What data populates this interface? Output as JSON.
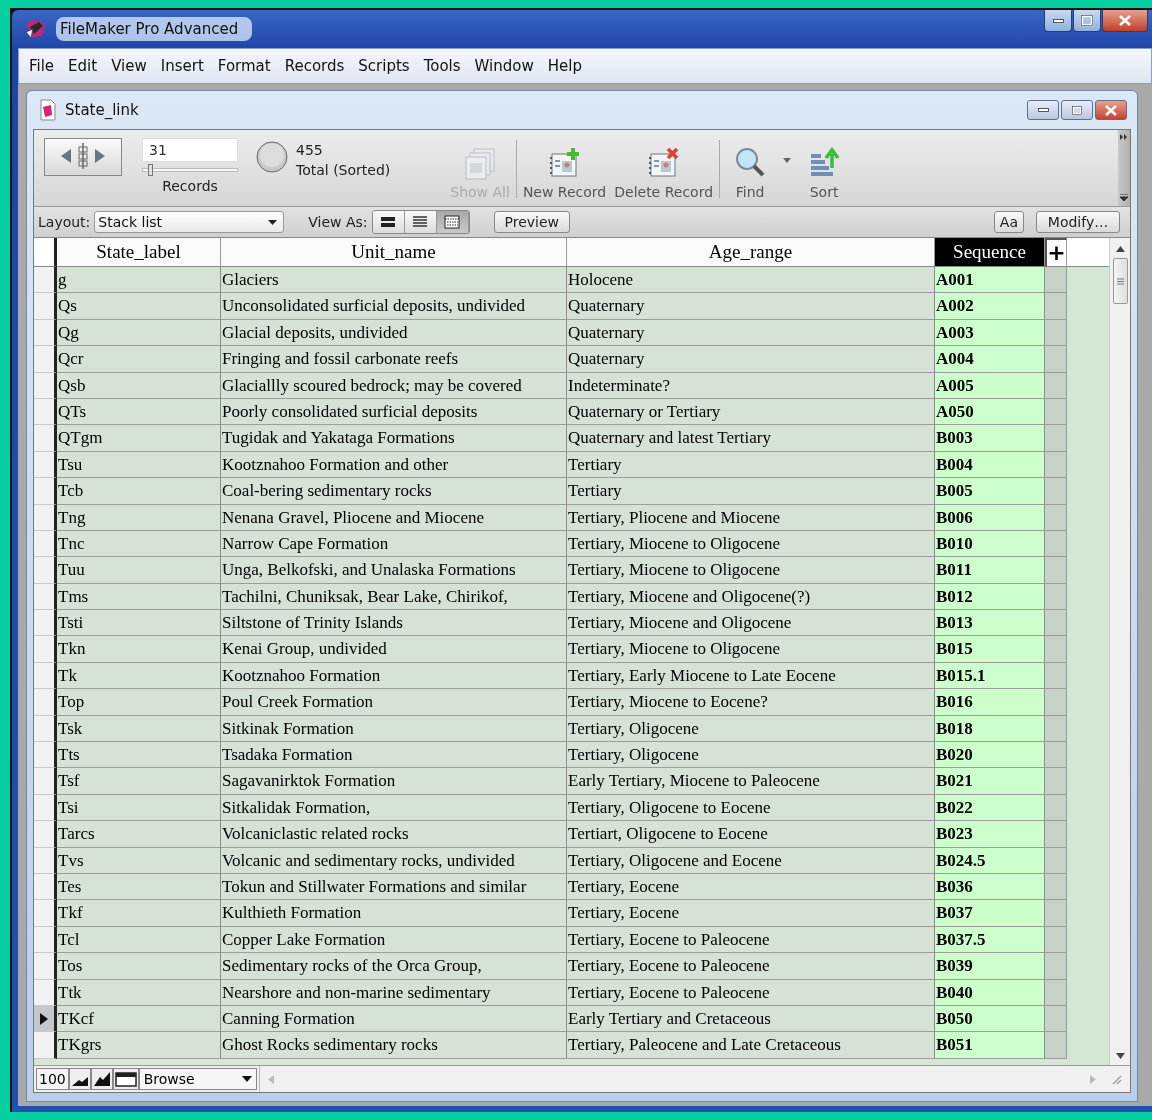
{
  "app": {
    "title": "FileMaker Pro Advanced"
  },
  "menu": [
    "File",
    "Edit",
    "View",
    "Insert",
    "Format",
    "Records",
    "Scripts",
    "Tools",
    "Window",
    "Help"
  ],
  "document": {
    "title": "State_link"
  },
  "toolbar": {
    "record_number": "31",
    "slider": {
      "level": 0.07
    },
    "records_label": "Records",
    "found_count": "455",
    "found_label": "Total (Sorted)",
    "buttons": [
      {
        "kind": "show-all",
        "label": "Show All",
        "disabled": true
      },
      {
        "kind": "new-record",
        "label": "New Record",
        "disabled": false
      },
      {
        "kind": "delete-record",
        "label": "Delete Record",
        "disabled": false
      },
      {
        "kind": "find",
        "label": "Find",
        "disabled": false
      },
      {
        "kind": "sort",
        "label": "Sort",
        "disabled": false
      }
    ]
  },
  "layout_bar": {
    "layout_label": "Layout:",
    "layout_value": "Stack list",
    "view_as_label": "View As:",
    "view_modes": [
      {
        "kind": "form",
        "selected": false
      },
      {
        "kind": "list",
        "selected": false
      },
      {
        "kind": "table",
        "selected": true
      }
    ],
    "preview": "Preview",
    "text_format": "Aa",
    "modify": "Modify…"
  },
  "table": {
    "columns": [
      {
        "label": "State_label",
        "sorted": false
      },
      {
        "label": "Unit_name",
        "sorted": false
      },
      {
        "label": "Age_range",
        "sorted": false
      },
      {
        "label": "Sequence",
        "sorted": true
      }
    ],
    "add_column": "+",
    "rows": [
      {
        "cells": [
          "g",
          "Glaciers",
          "Holocene",
          "A001"
        ],
        "selected": false
      },
      {
        "cells": [
          "Qs",
          "Unconsolidated surficial deposits, undivided",
          "Quaternary",
          "A002"
        ],
        "selected": false
      },
      {
        "cells": [
          "Qg",
          "Glacial deposits, undivided",
          "Quaternary",
          "A003"
        ],
        "selected": false
      },
      {
        "cells": [
          "Qcr",
          "Fringing and fossil carbonate reefs",
          "Quaternary",
          "A004"
        ],
        "selected": false
      },
      {
        "cells": [
          "Qsb",
          "Glaciallly scoured bedrock; may be covered",
          "Indeterminate?",
          "A005"
        ],
        "selected": false
      },
      {
        "cells": [
          "QTs",
          "Poorly consolidated surficial deposits",
          "Quaternary or Tertiary",
          "A050"
        ],
        "selected": false
      },
      {
        "cells": [
          "QTgm",
          "Tugidak and Yakataga Formations",
          "Quaternary and latest Tertiary",
          "B003"
        ],
        "selected": false
      },
      {
        "cells": [
          "Tsu",
          "Kootznahoo Formation and other",
          "Tertiary",
          "B004"
        ],
        "selected": false
      },
      {
        "cells": [
          "Tcb",
          "Coal-bering sedimentary rocks",
          "Tertiary",
          "B005"
        ],
        "selected": false
      },
      {
        "cells": [
          "Tng",
          "Nenana Gravel, Pliocene and Miocene",
          "Tertiary, Pliocene and Miocene",
          "B006"
        ],
        "selected": false
      },
      {
        "cells": [
          "Tnc",
          "Narrow Cape Formation",
          "Tertiary, Miocene to Oligocene",
          "B010"
        ],
        "selected": false
      },
      {
        "cells": [
          "Tuu",
          "Unga, Belkofski, and Unalaska Formations",
          "Tertiary, Miocene to Oligocene",
          "B011"
        ],
        "selected": false
      },
      {
        "cells": [
          "Tms",
          "Tachilni, Chuniksak, Bear Lake, Chirikof,",
          "Tertiary, Miocene and Oligocene(?)",
          "B012"
        ],
        "selected": false
      },
      {
        "cells": [
          "Tsti",
          "Siltstone of Trinity Islands",
          "Tertiary, Miocene and Oligocene",
          "B013"
        ],
        "selected": false
      },
      {
        "cells": [
          "Tkn",
          "Kenai Group, undivided",
          "Tertiary, Miocene to Oligocene",
          "B015"
        ],
        "selected": false
      },
      {
        "cells": [
          "Tk",
          "Kootznahoo Formation",
          "Tertiary, Early Miocene to Late Eocene",
          "B015.1"
        ],
        "selected": false
      },
      {
        "cells": [
          "Top",
          "Poul Creek Formation",
          "Tertiary, Miocene to Eocene?",
          "B016"
        ],
        "selected": false
      },
      {
        "cells": [
          "Tsk",
          "Sitkinak Formation",
          "Tertiary, Oligocene",
          "B018"
        ],
        "selected": false
      },
      {
        "cells": [
          "Tts",
          "Tsadaka Formation",
          "Tertiary, Oligocene",
          "B020"
        ],
        "selected": false
      },
      {
        "cells": [
          "Tsf",
          "Sagavanirktok Formation",
          "Early Tertiary, Miocene to Paleocene",
          "B021"
        ],
        "selected": false
      },
      {
        "cells": [
          "Tsi",
          "Sitkalidak Formation,",
          "Tertiary, Oligocene to Eocene",
          "B022"
        ],
        "selected": false
      },
      {
        "cells": [
          "Tarcs",
          "Volcaniclastic related rocks",
          "Tertiart, Oligocene to Eocene",
          "B023"
        ],
        "selected": false
      },
      {
        "cells": [
          "Tvs",
          "Volcanic and sedimentary rocks, undivided",
          "Tertiary, Oligocene and Eocene",
          "B024.5"
        ],
        "selected": false
      },
      {
        "cells": [
          "Tes",
          "Tokun and Stillwater Formations and similar",
          "Tertiary, Eocene",
          "B036"
        ],
        "selected": false
      },
      {
        "cells": [
          "Tkf",
          "Kulthieth Formation",
          "Tertiary, Eocene",
          "B037"
        ],
        "selected": false
      },
      {
        "cells": [
          "Tcl",
          "Copper Lake Formation",
          "Tertiary, Eocene to Paleocene",
          "B037.5"
        ],
        "selected": false
      },
      {
        "cells": [
          "Tos",
          "Sedimentary rocks of the Orca Group,",
          "Tertiary, Eocene to Paleocene",
          "B039"
        ],
        "selected": false
      },
      {
        "cells": [
          "Ttk",
          "Nearshore and non-marine sedimentary",
          "Tertiary, Eocene to Paleocene",
          "B040"
        ],
        "selected": false
      },
      {
        "cells": [
          "TKcf",
          "Canning Formation",
          "Early Tertiary and Cretaceous",
          "B050"
        ],
        "selected": true
      },
      {
        "cells": [
          "TKgrs",
          "Ghost Rocks sedimentary rocks",
          "Tertiary, Paleocene and Late Cretaceous",
          "B051"
        ],
        "selected": false
      }
    ]
  },
  "status_bar": {
    "zoom": "100",
    "mode": "Browse"
  }
}
